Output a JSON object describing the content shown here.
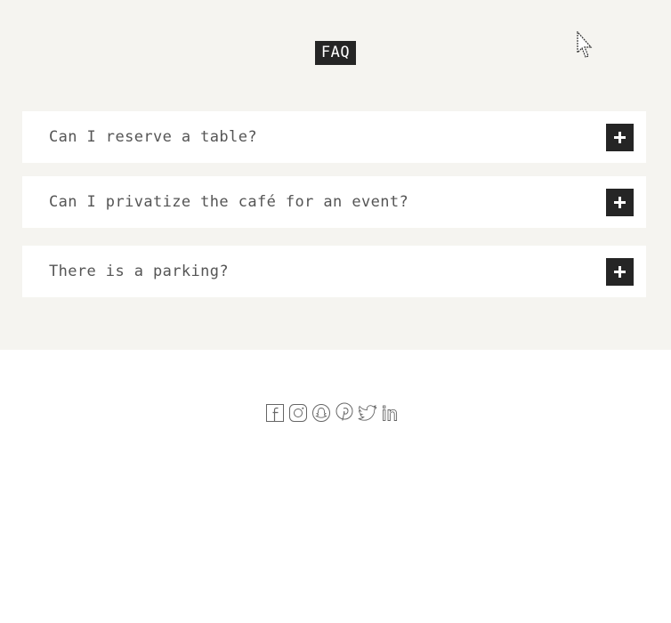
{
  "faq": {
    "title": "FAQ",
    "items": [
      {
        "question": "Can I reserve a table?"
      },
      {
        "question": "Can I privatize the café for an event?"
      },
      {
        "question": "There is a parking?"
      }
    ]
  },
  "social": {
    "icons": [
      "facebook-icon",
      "instagram-icon",
      "snapchat-icon",
      "pinterest-icon",
      "twitter-icon",
      "linkedin-icon"
    ]
  },
  "colors": {
    "faq_background": "#f5f4f0",
    "button_dark": "#252525",
    "text": "#555555",
    "page_background": "#ffffff"
  }
}
